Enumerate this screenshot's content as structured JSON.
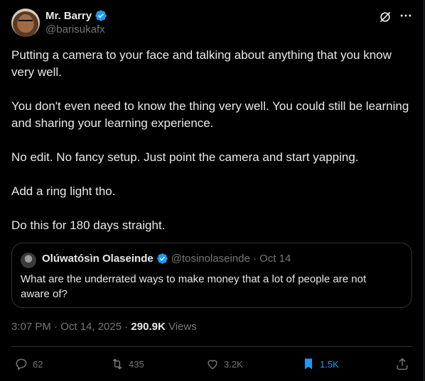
{
  "author": {
    "name": "Mr. Barry",
    "handle": "@barisukafx"
  },
  "icons": {
    "verified": "verified-badge-icon",
    "grok": "grok-icon",
    "more": "more-icon"
  },
  "post": {
    "paragraphs": [
      "Putting a camera to your face and talking about anything that you know very well.",
      "You don't even need to know the thing very well. You could still be learning and sharing your learning experience.",
      "No edit. No fancy setup. Just point the camera and start yapping.",
      "Add a ring light tho.",
      "Do this for 180 days straight."
    ]
  },
  "quoted": {
    "name": "Olúwatósìn Olaseinde",
    "meta": "@tosinolaseinde · Oct 14",
    "text": "What are the underrated ways to make money that a lot of people are not aware of?"
  },
  "meta": {
    "time": "3:07 PM · Oct 14, 2025 · ",
    "views_count": "290.9K",
    "views_label": " Views"
  },
  "actions": {
    "replies": "62",
    "reposts": "435",
    "likes": "3.2K",
    "bookmarks": "1.5K"
  },
  "colors": {
    "accent": "#1d9bf0",
    "muted": "#71767b",
    "text": "#e7e9ea",
    "border": "#2f3336"
  }
}
